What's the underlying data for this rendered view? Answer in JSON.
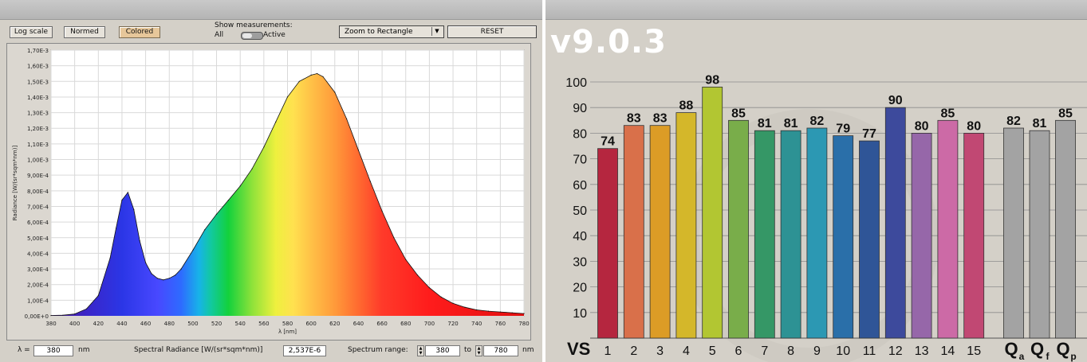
{
  "left": {
    "toolbar": {
      "log_scale": "Log scale",
      "normed": "Normed",
      "colored": "Colored",
      "show_measurements": "Show measurements:",
      "all": "All",
      "active": "Active",
      "zoom_mode": "Zoom to Rectangle",
      "reset": "RESET"
    },
    "bottom": {
      "lambda_label": "λ =",
      "lambda_value": "380",
      "lambda_unit": "nm",
      "radiance_label": "Spectral Radiance [W/(sr*sqm*nm)]",
      "radiance_value": "2,537E-6",
      "range_label": "Spectrum range:",
      "range_from": "380",
      "range_to_label": "to",
      "range_to": "780",
      "range_unit": "nm"
    }
  },
  "right": {
    "version": "v9.0.3",
    "vs_label": "VS"
  },
  "chart_data": [
    {
      "type": "area",
      "xlabel": "λ [nm]",
      "ylabel": "Radiance [W/(sr*sqm*nm)]",
      "xlim": [
        380,
        780
      ],
      "ylim": [
        0,
        0.0017
      ],
      "xticks": [
        "380",
        "400",
        "420",
        "440",
        "460",
        "480",
        "500",
        "520",
        "540",
        "560",
        "580",
        "600",
        "620",
        "640",
        "660",
        "680",
        "700",
        "720",
        "740",
        "760",
        "780"
      ],
      "yticks": [
        "0,00E+0",
        "1,00E-4",
        "2,00E-4",
        "3,00E-4",
        "4,00E-4",
        "5,00E-4",
        "6,00E-4",
        "7,00E-4",
        "8,00E-4",
        "9,00E-4",
        "1,00E-3",
        "1,10E-3",
        "1,20E-3",
        "1,30E-3",
        "1,40E-3",
        "1,50E-3",
        "1,60E-3",
        "1,70E-3"
      ],
      "grid": true,
      "colored_fill": true,
      "x": [
        380,
        390,
        400,
        410,
        420,
        430,
        435,
        440,
        445,
        450,
        455,
        460,
        465,
        470,
        475,
        480,
        485,
        490,
        500,
        510,
        520,
        530,
        540,
        550,
        560,
        570,
        580,
        590,
        600,
        605,
        610,
        620,
        630,
        640,
        650,
        660,
        670,
        680,
        690,
        700,
        710,
        720,
        730,
        740,
        750,
        760,
        770,
        780
      ],
      "y": [
        2.5e-06,
        4e-06,
        1.2e-05,
        4.5e-05,
        0.00013,
        0.00037,
        0.00056,
        0.00074,
        0.00079,
        0.00068,
        0.00048,
        0.00034,
        0.00027,
        0.00024,
        0.00023,
        0.00024,
        0.00026,
        0.0003,
        0.00042,
        0.00055,
        0.00065,
        0.00074,
        0.00083,
        0.00094,
        0.00108,
        0.00124,
        0.0014,
        0.0015,
        0.00154,
        0.00155,
        0.00153,
        0.00143,
        0.00126,
        0.00106,
        0.00086,
        0.00067,
        0.0005,
        0.00036,
        0.00026,
        0.00018,
        0.00012,
        8e-05,
        5.5e-05,
        3.8e-05,
        3e-05,
        2.5e-05,
        2e-05,
        1.5e-05
      ]
    },
    {
      "type": "bar",
      "ylim": [
        0,
        100
      ],
      "yticks": [
        "10",
        "20",
        "30",
        "40",
        "50",
        "60",
        "70",
        "80",
        "90",
        "100"
      ],
      "categories": [
        "1",
        "2",
        "3",
        "4",
        "5",
        "6",
        "7",
        "8",
        "9",
        "10",
        "11",
        "12",
        "13",
        "14",
        "15",
        "Qa",
        "Qf",
        "Qp"
      ],
      "category_main": [
        "1",
        "2",
        "3",
        "4",
        "5",
        "6",
        "7",
        "8",
        "9",
        "10",
        "11",
        "12",
        "13",
        "14",
        "15",
        "Q",
        "Q",
        "Q"
      ],
      "category_sub": [
        "",
        "",
        "",
        "",
        "",
        "",
        "",
        "",
        "",
        "",
        "",
        "",
        "",
        "",
        "",
        "a",
        "f",
        "p"
      ],
      "values": [
        74,
        83,
        83,
        88,
        98,
        85,
        81,
        81,
        82,
        79,
        77,
        90,
        80,
        85,
        80,
        82,
        81,
        85
      ],
      "colors": [
        "#b5263f",
        "#d9704a",
        "#dc9c26",
        "#d4b72a",
        "#b2c632",
        "#79ad4a",
        "#359766",
        "#2d9294",
        "#2c98b3",
        "#2a6fa9",
        "#2f5597",
        "#3d4a9c",
        "#9667a9",
        "#cc6aa6",
        "#c14873",
        "#a3a3a3",
        "#a3a3a3",
        "#a3a3a3"
      ]
    }
  ]
}
